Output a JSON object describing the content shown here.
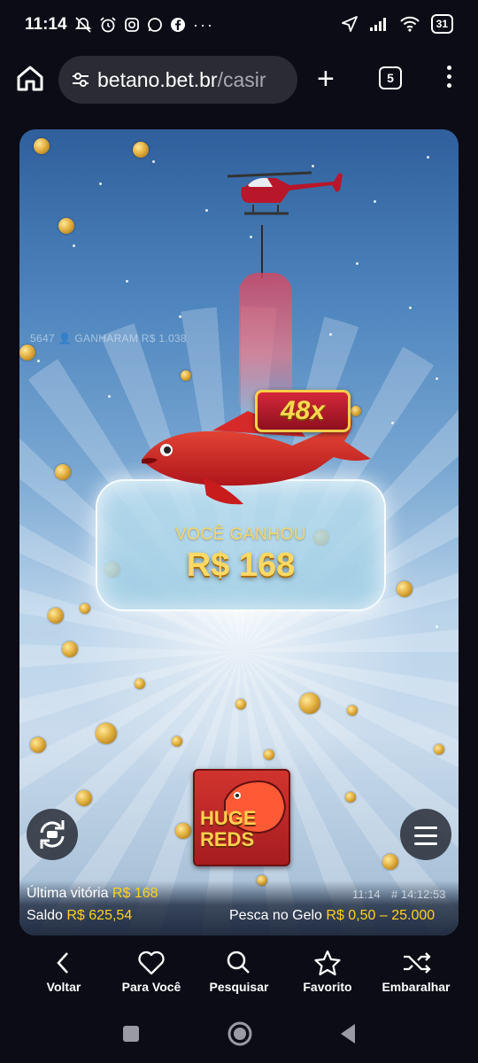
{
  "status_bar": {
    "time": "11:14",
    "battery": "31",
    "icons": [
      "mute-icon",
      "alarm-icon",
      "instagram-icon",
      "whatsapp-icon",
      "facebook-icon",
      "more-icon",
      "location-icon",
      "signal-icon",
      "wifi-icon",
      "battery-icon"
    ],
    "more": "···"
  },
  "browser": {
    "url_domain": "betano.bet.br",
    "url_path": "/casir",
    "tabs_count": "5",
    "new_tab": "+"
  },
  "game": {
    "ticker": "5647 👤 GANHARAM R$ 1.038",
    "multiplier": "48x",
    "win_label": "VOCÊ GANHOU",
    "win_amount": "R$ 168",
    "logo_text_1": "HUGE",
    "logo_text_2": "REDS",
    "footer": {
      "last_win_label": "Última vitória",
      "last_win_value": "R$ 168",
      "balance_label": "Saldo",
      "balance_value": "R$ 625,54",
      "time": "11:14",
      "round_id": "# 14:12:53",
      "game_name": "Pesca no Gelo",
      "bet_range": "R$ 0,50 – 25.000"
    }
  },
  "bottom_nav": {
    "items": [
      {
        "label": "Voltar",
        "icon": "chevron-left-icon"
      },
      {
        "label": "Para Você",
        "icon": "heart-icon"
      },
      {
        "label": "Pesquisar",
        "icon": "search-icon"
      },
      {
        "label": "Favorito",
        "icon": "star-icon"
      },
      {
        "label": "Embaralhar",
        "icon": "shuffle-icon"
      }
    ]
  },
  "colors": {
    "accent_gold": "#ffd21f",
    "win_gold": "#ffd966",
    "background": "#0b0c16",
    "badge_red": "#d6283a"
  }
}
